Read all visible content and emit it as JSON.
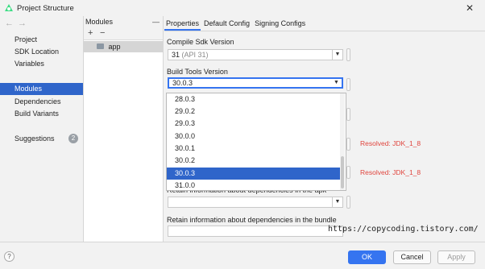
{
  "window": {
    "title": "Project Structure",
    "close_glyph": "✕"
  },
  "nav": {
    "arrows": "←→",
    "items": [
      {
        "label": "Project"
      },
      {
        "label": "SDK Location"
      },
      {
        "label": "Variables"
      },
      {
        "label": "Modules"
      },
      {
        "label": "Dependencies"
      },
      {
        "label": "Build Variants"
      },
      {
        "label": "Suggestions",
        "badge": "2"
      }
    ]
  },
  "modules": {
    "header": "Modules",
    "collapse_glyph": "—",
    "add_glyph": "+",
    "remove_glyph": "−",
    "items": [
      {
        "label": "app"
      }
    ]
  },
  "tabs": [
    {
      "label": "Properties",
      "active": true
    },
    {
      "label": "Default Config"
    },
    {
      "label": "Signing Configs"
    }
  ],
  "compile_sdk": {
    "label": "Compile Sdk Version",
    "value": "31",
    "hint": "(API 31)"
  },
  "build_tools": {
    "label": "Build Tools Version",
    "value": "30.0.3"
  },
  "dropdown": {
    "options": [
      "28.0.3",
      "29.0.2",
      "29.0.3",
      "30.0.0",
      "30.0.1",
      "30.0.2",
      "30.0.3",
      "31.0.0"
    ],
    "selected_index": 6
  },
  "resolved": {
    "text1": "Resolved: JDK_1_8",
    "text2": "Resolved: JDK_1_8"
  },
  "dependencies_apk": {
    "label_partial": "Retain information about dependencies in the apk"
  },
  "dependencies_bundle": {
    "label": "Retain information about dependencies in the bundle"
  },
  "watermark": "https://copycoding.tistory.com/",
  "footer": {
    "help": "?",
    "ok": "OK",
    "cancel": "Cancel",
    "apply": "Apply"
  },
  "colors": {
    "accent": "#3574f0",
    "selection": "#2f65ca",
    "error": "#e0453e"
  }
}
